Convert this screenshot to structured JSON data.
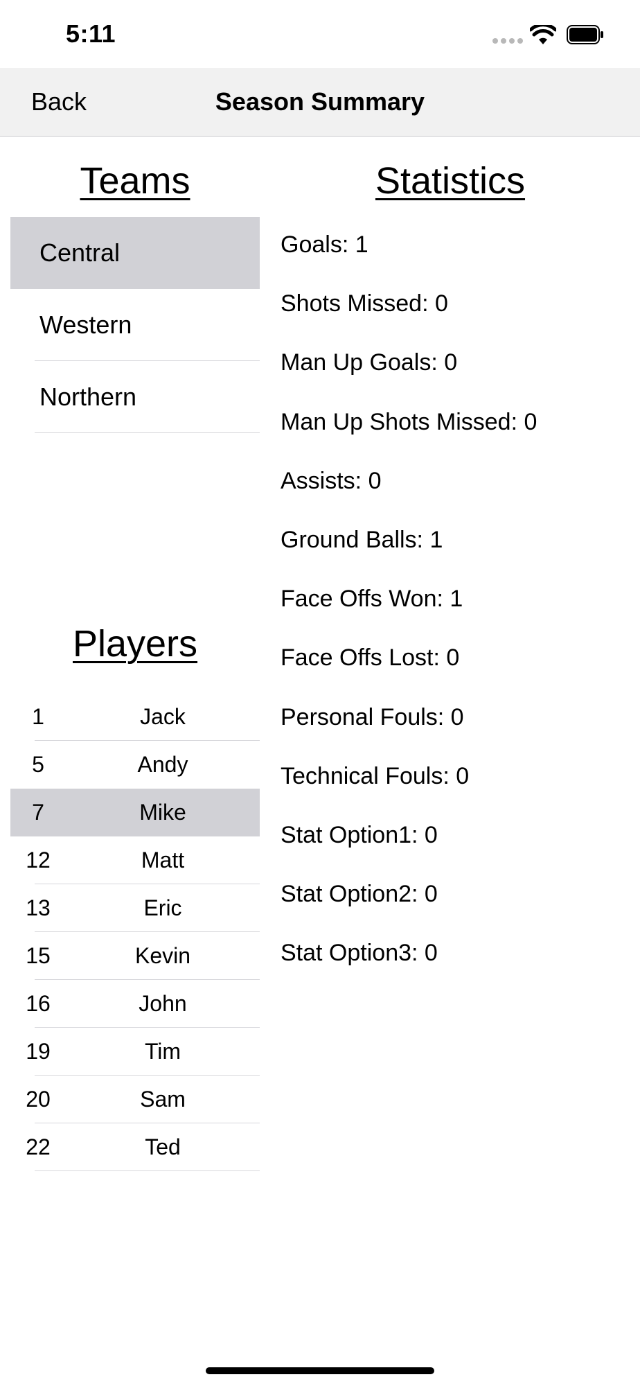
{
  "status_bar": {
    "time": "5:11"
  },
  "nav": {
    "back_label": "Back",
    "title": "Season Summary"
  },
  "teams": {
    "heading": "Teams",
    "items": [
      {
        "label": "Central",
        "selected": true
      },
      {
        "label": "Western",
        "selected": false
      },
      {
        "label": "Northern",
        "selected": false
      }
    ]
  },
  "players": {
    "heading": "Players",
    "items": [
      {
        "number": "1",
        "name": "Jack",
        "selected": false
      },
      {
        "number": "5",
        "name": "Andy",
        "selected": false
      },
      {
        "number": "7",
        "name": "Mike",
        "selected": true
      },
      {
        "number": "12",
        "name": "Matt",
        "selected": false
      },
      {
        "number": "13",
        "name": "Eric",
        "selected": false
      },
      {
        "number": "15",
        "name": "Kevin",
        "selected": false
      },
      {
        "number": "16",
        "name": "John",
        "selected": false
      },
      {
        "number": "19",
        "name": "Tim",
        "selected": false
      },
      {
        "number": "20",
        "name": "Sam",
        "selected": false
      },
      {
        "number": "22",
        "name": "Ted",
        "selected": false
      }
    ]
  },
  "statistics": {
    "heading": "Statistics",
    "items": [
      "Goals: 1",
      "Shots Missed: 0",
      "Man Up Goals: 0",
      "Man Up Shots Missed: 0",
      "Assists: 0",
      "Ground Balls: 1",
      "Face Offs Won: 1",
      "Face Offs Lost: 0",
      "Personal Fouls: 0",
      "Technical Fouls: 0",
      "Stat Option1: 0",
      "Stat Option2: 0",
      "Stat Option3: 0"
    ]
  },
  "colors": {
    "selected_row": "#d1d1d6",
    "nav_background": "#f1f1f1",
    "separator": "#d7d7db"
  },
  "icons": [
    "cellular-signal-icon",
    "wifi-icon",
    "battery-icon"
  ]
}
